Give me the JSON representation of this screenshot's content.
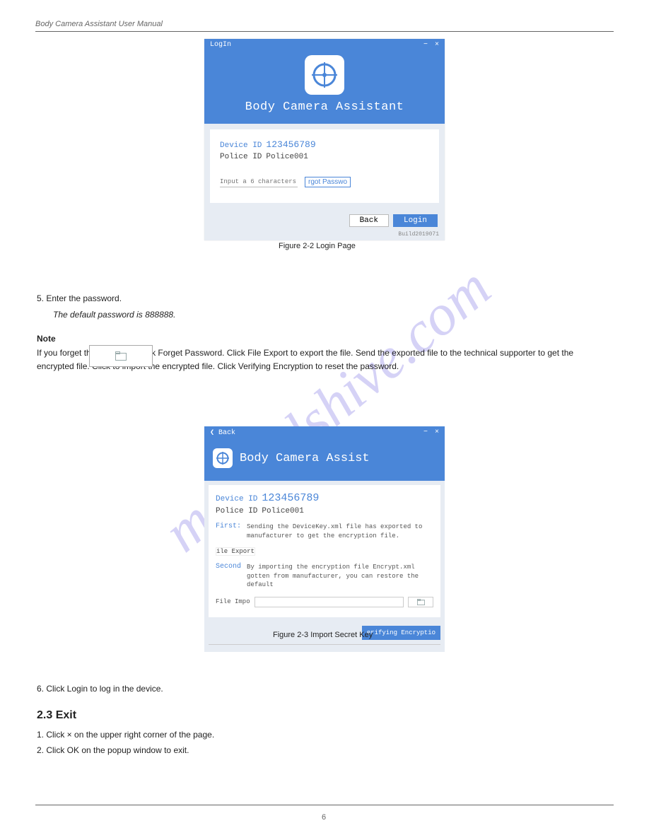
{
  "page": {
    "header_text": "Body Camera Assistant User Manual",
    "footer_page": "6"
  },
  "login_dialog": {
    "titlebar": "LogIn",
    "app_title": "Body Camera Assistant",
    "device_id_label": "Device ID",
    "device_id_value": "123456789",
    "police_id_label": "Police ID",
    "police_id_value": "Police001",
    "password_placeholder": "Input a 6 characters' …",
    "forgot_label": "rgot Passwo",
    "back_btn": "Back",
    "login_btn": "Login",
    "build": "Build2019071"
  },
  "login_caption": "Figure 2-2   Login Page",
  "steps": {
    "s5": "5.  Enter the password.",
    "s5_note": "The default password is 888888.",
    "s5_note2": "Note",
    "s5_body": "If you forget the password, click Forget Password. Click File Export to export the file. Send the exported file to the technical supporter to get the encrypted file. Click          to import the encrypted file. Click Verifying Encryption to reset the password.",
    "s6": "6.  Click Login to log in the device."
  },
  "import_dialog": {
    "back": "Back",
    "app_title": "Body Camera Assist",
    "device_id_label": "Device ID",
    "device_id_value": "123456789",
    "police_id_label": "Police ID",
    "police_id_value": "Police001",
    "first_label": "First:",
    "first_text": "Sending the DeviceKey.xml file has exported to manufacturer to get the encryption file.",
    "export_btn": "ile Export",
    "second_label": "Second",
    "second_text": "By importing the encryption file Encrypt.xml gotten from manufacturer, you can restore the default",
    "file_import_label": "File Impo",
    "verify_btn": "erifying Encryptio"
  },
  "import_caption": "Figure 2-3   Import Secret Key",
  "next_section": {
    "heading": "2.3  Exit",
    "step1": "1.  Click  ×  on the upper right corner of the page.",
    "step2": "2.  Click OK on the popup window to exit."
  },
  "icons": {
    "minimize": "−",
    "close": "×",
    "back_arrow": "❮"
  }
}
